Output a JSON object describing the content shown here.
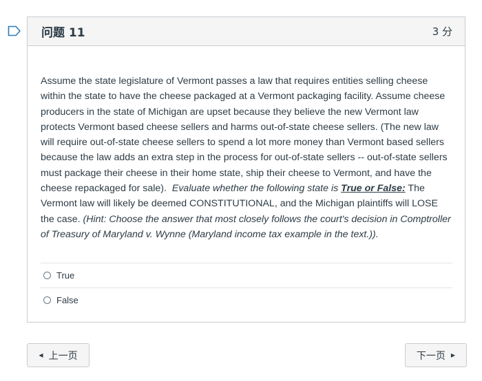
{
  "question": {
    "title": "问题 11",
    "points": "3 分",
    "text_plain": "Assume the state legislature of Vermont passes a law that requires entities selling cheese within the state to have the cheese packaged at a Vermont packaging facility. Assume cheese producers in the state of Michigan are upset because they believe the new Vermont law protects Vermont based cheese sellers and harms out-of-state cheese sellers. (The new law will require out-of-state cheese sellers to spend a lot more money than Vermont based sellers because the law adds an extra step in the process for out-of-state sellers -- out-of-state sellers must package their cheese in their home state, ship their cheese to Vermont, and have the cheese repackaged for sale).",
    "text_italic": "Evaluate whether the following state is",
    "text_bold_underline": "True or False:",
    "statement": "The Vermont law will likely be deemed CONSTITUTIONAL, and the Michigan plaintiffs will LOSE the case.",
    "hint": "(Hint: Choose the answer that most closely follows the court's decision in Comptroller of Treasury of Maryland v. Wynne (Maryland income tax example in the text.))."
  },
  "answers": [
    {
      "label": "True",
      "selected": false
    },
    {
      "label": "False",
      "selected": false
    }
  ],
  "navigation": {
    "prev_label": "上一页",
    "next_label": "下一页"
  },
  "icons": {
    "flag": "bookmark-flag-icon",
    "prev": "triangle-left-icon",
    "next": "triangle-right-icon"
  },
  "colors": {
    "flag": "#2b7abc",
    "text": "#2d3b45",
    "header_bg": "#f5f5f5",
    "border": "#c7cdd1"
  }
}
